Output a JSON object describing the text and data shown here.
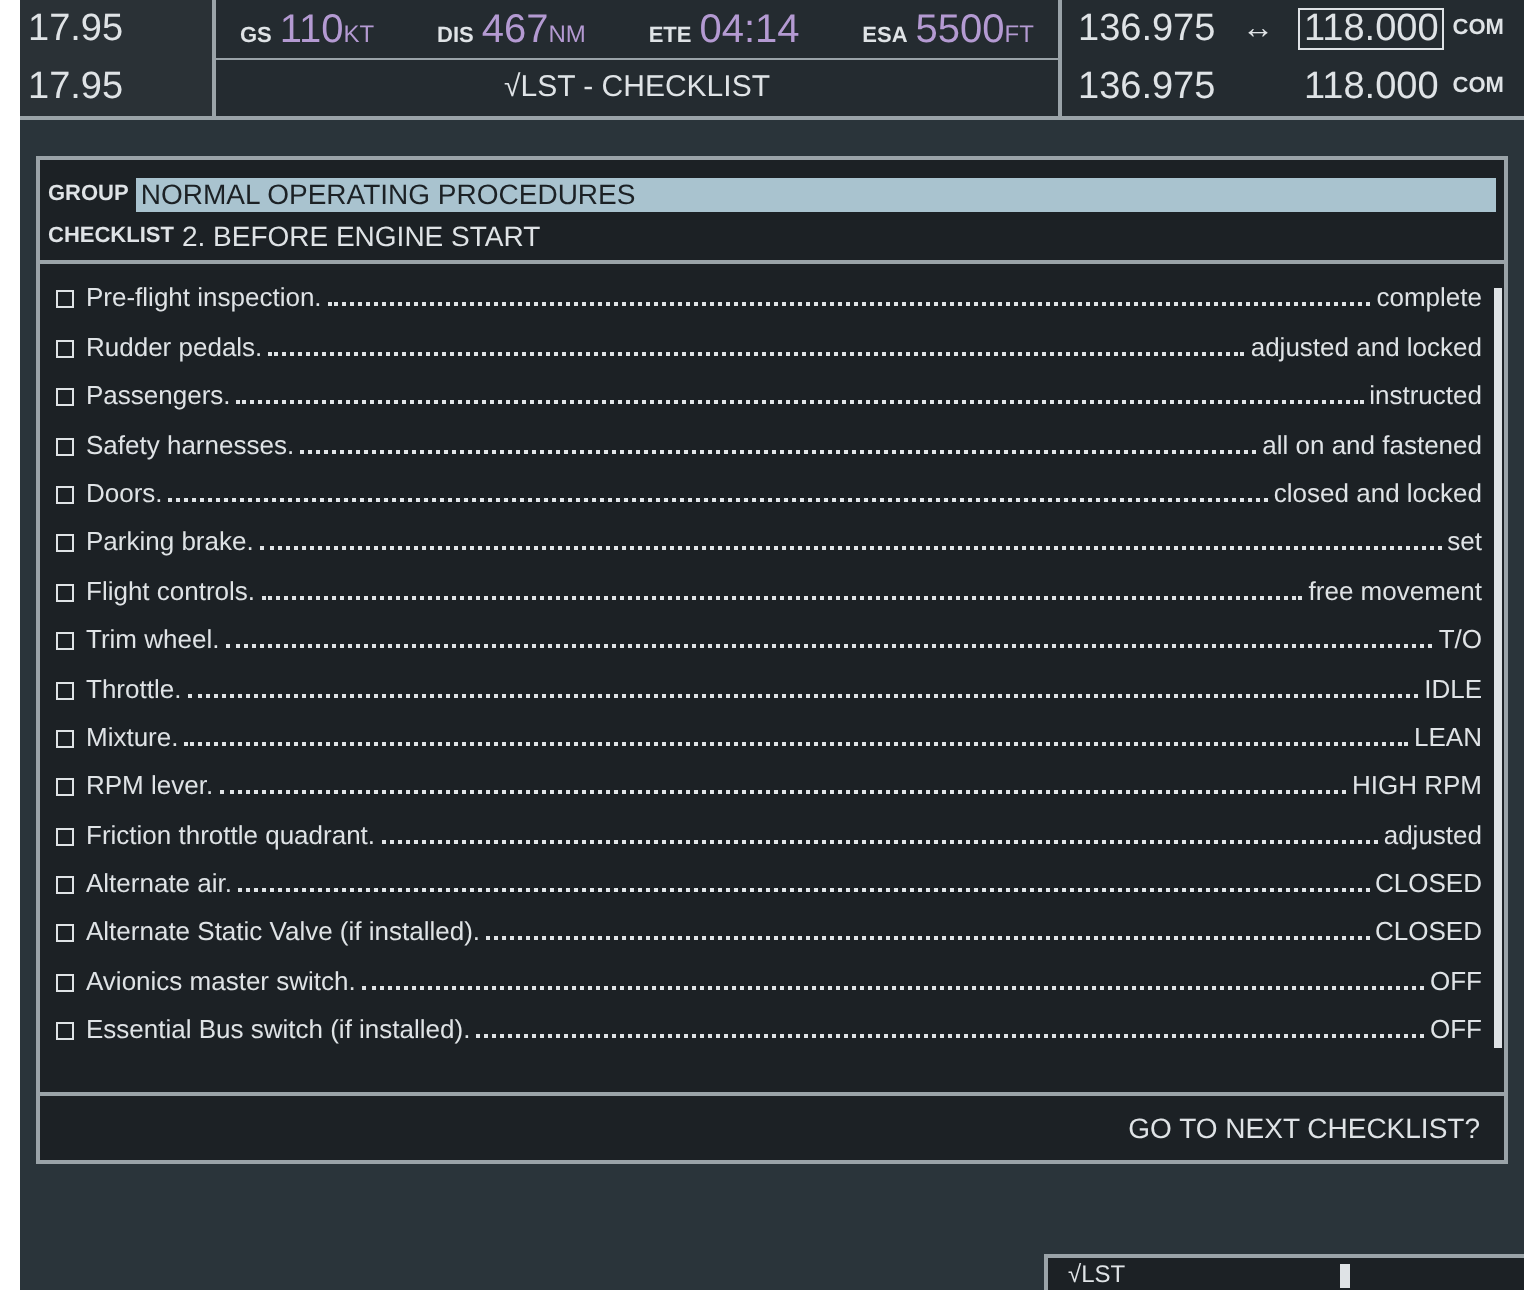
{
  "nav_frequencies": [
    "17.95",
    "17.95"
  ],
  "data_fields": [
    {
      "label": "GS",
      "value": "110",
      "unit": "KT"
    },
    {
      "label": "DIS",
      "value": "467",
      "unit": "NM"
    },
    {
      "label": "ETE",
      "value": "04:14"
    },
    {
      "label": "ESA",
      "value": "5500",
      "unit": "FT"
    }
  ],
  "page_title": "√LST - CHECKLIST",
  "com_rows": [
    {
      "standby": "136.975",
      "swap": "↔",
      "active": "118.000",
      "label": "COM",
      "selected": true
    },
    {
      "standby": "136.975",
      "active": "118.000",
      "label": "COM",
      "selected": false
    }
  ],
  "group": {
    "label": "GROUP",
    "value": "NORMAL OPERATING PROCEDURES",
    "selected": true
  },
  "checklist": {
    "label": "CHECKLIST",
    "value": "2. BEFORE ENGINE START"
  },
  "items": [
    {
      "name": "Pre-flight inspection.",
      "action": "complete",
      "checked": false
    },
    {
      "name": "Rudder pedals.",
      "action": "adjusted and locked",
      "checked": false
    },
    {
      "name": "Passengers.",
      "action": "instructed",
      "checked": false
    },
    {
      "name": "Safety harnesses.",
      "action": "all on and fastened",
      "checked": false
    },
    {
      "name": "Doors.",
      "action": "closed and locked",
      "checked": false
    },
    {
      "name": "Parking brake.",
      "action": "set",
      "checked": false
    },
    {
      "name": "Flight controls.",
      "action": "free movement",
      "checked": false
    },
    {
      "name": "Trim wheel.",
      "action": "T/O",
      "checked": false
    },
    {
      "name": "Throttle.",
      "action": "IDLE",
      "checked": false
    },
    {
      "name": "Mixture.",
      "action": "LEAN",
      "checked": false
    },
    {
      "name": "RPM lever.",
      "action": "HIGH RPM",
      "checked": false
    },
    {
      "name": "Friction throttle quadrant.",
      "action": "adjusted",
      "checked": false
    },
    {
      "name": "Alternate air.",
      "action": "CLOSED",
      "checked": false
    },
    {
      "name": "Alternate Static Valve (if installed).",
      "action": "CLOSED",
      "checked": false
    },
    {
      "name": "Avionics master switch.",
      "action": "OFF",
      "checked": false
    },
    {
      "name": "Essential Bus switch (if installed).",
      "action": "OFF",
      "checked": false
    }
  ],
  "footer_prompt": "GO TO NEXT CHECKLIST?",
  "softkey": {
    "label": "√LST"
  }
}
